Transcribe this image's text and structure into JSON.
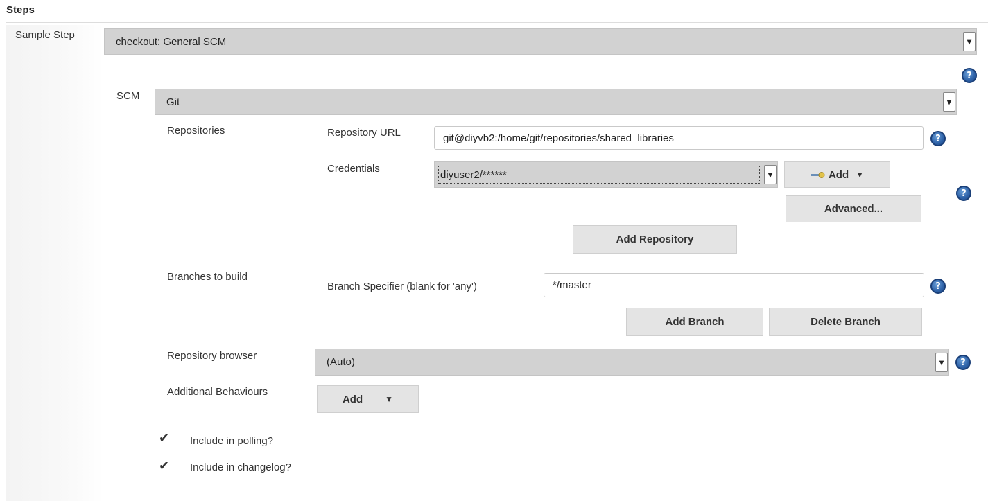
{
  "section": {
    "title": "Steps"
  },
  "sample_step": {
    "label": "Sample Step",
    "value": "checkout: General SCM"
  },
  "scm": {
    "label": "SCM",
    "value": "Git"
  },
  "repositories": {
    "label": "Repositories",
    "url_label": "Repository URL",
    "url_value": "git@diyvb2:/home/git/repositories/shared_libraries",
    "credentials_label": "Credentials",
    "credentials_value": "diyuser2/******",
    "add_label": "Add",
    "advanced_label": "Advanced...",
    "add_repository_label": "Add Repository"
  },
  "branches": {
    "label": "Branches to build",
    "specifier_label": "Branch Specifier (blank for 'any')",
    "specifier_value": "*/master",
    "add_branch_label": "Add Branch",
    "delete_branch_label": "Delete Branch"
  },
  "repo_browser": {
    "label": "Repository browser",
    "value": "(Auto)"
  },
  "additional_behaviours": {
    "label": "Additional Behaviours",
    "add_label": "Add"
  },
  "options": {
    "polling_label": "Include in polling?",
    "polling_checked": true,
    "changelog_label": "Include in changelog?",
    "changelog_checked": true
  },
  "icons": {
    "help": "help-icon",
    "key": "key-icon",
    "dropdown": "caret-down-icon",
    "check": "checkmark-icon"
  },
  "colors": {
    "select_bg": "#d2d2d2",
    "button_bg": "#e4e4e4",
    "help_blue": "#2e62a8"
  }
}
